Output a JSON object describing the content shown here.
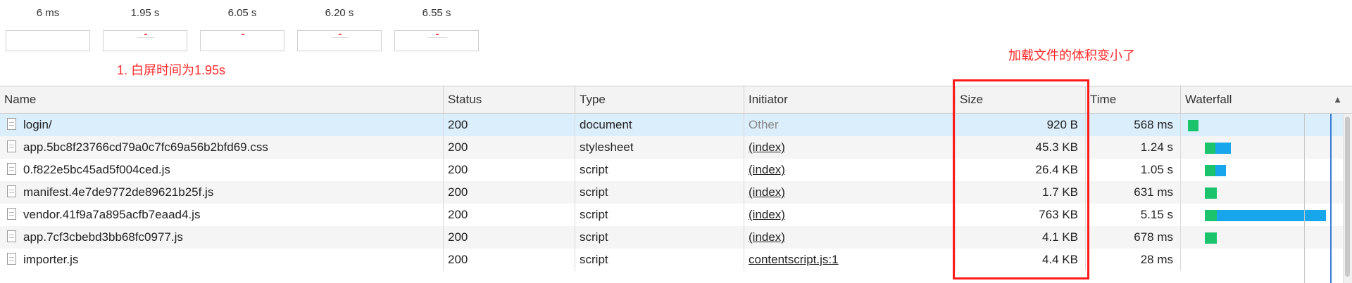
{
  "filmstrip": {
    "frames": [
      {
        "time": "6 ms"
      },
      {
        "time": "1.95 s"
      },
      {
        "time": "6.05 s"
      },
      {
        "time": "6.20 s"
      },
      {
        "time": "6.55 s"
      }
    ]
  },
  "annotations": {
    "white_screen": "1. 白屏时间为1.95s",
    "size_note": "加载文件的体积变小了"
  },
  "columns": {
    "name": "Name",
    "status": "Status",
    "type": "Type",
    "initiator": "Initiator",
    "size": "Size",
    "time": "Time",
    "waterfall": "Waterfall"
  },
  "rows": [
    {
      "name": "login/",
      "status": "200",
      "type": "document",
      "initiator": "Other",
      "size": "920 B",
      "time": "568 ms",
      "wf_green": [
        0.0,
        0.07
      ],
      "wf_blue": null
    },
    {
      "name": "app.5bc8f23766cd79a0c7fc69a56b2bfd69.css",
      "status": "200",
      "type": "stylesheet",
      "initiator": "(index)",
      "size": "45.3 KB",
      "time": "1.24 s",
      "wf_green": [
        0.11,
        0.18
      ],
      "wf_blue": [
        0.18,
        0.28
      ]
    },
    {
      "name": "0.f822e5bc45ad5f004ced.js",
      "status": "200",
      "type": "script",
      "initiator": "(index)",
      "size": "26.4 KB",
      "time": "1.05 s",
      "wf_green": [
        0.11,
        0.18
      ],
      "wf_blue": [
        0.18,
        0.25
      ]
    },
    {
      "name": "manifest.4e7de9772de89621b25f.js",
      "status": "200",
      "type": "script",
      "initiator": "(index)",
      "size": "1.7 KB",
      "time": "631 ms",
      "wf_green": [
        0.11,
        0.19
      ],
      "wf_blue": null
    },
    {
      "name": "vendor.41f9a7a895acfb7eaad4.js",
      "status": "200",
      "type": "script",
      "initiator": "(index)",
      "size": "763 KB",
      "time": "5.15 s",
      "wf_green": [
        0.11,
        0.19
      ],
      "wf_blue": [
        0.19,
        0.91
      ]
    },
    {
      "name": "app.7cf3cbebd3bb68fc0977.js",
      "status": "200",
      "type": "script",
      "initiator": "(index)",
      "size": "4.1 KB",
      "time": "678 ms",
      "wf_green": [
        0.11,
        0.19
      ],
      "wf_blue": null
    },
    {
      "name": "importer.js",
      "status": "200",
      "type": "script",
      "initiator": "contentscript.js:1",
      "size": "4.4 KB",
      "time": "28 ms",
      "wf_green": null,
      "wf_blue": null
    }
  ],
  "colors": {
    "wf_green": "#1cc36d",
    "wf_blue": "#17a6ec",
    "annotation": "#ff2a2a",
    "selected_row": "#dbeefb"
  },
  "icons": {
    "file": "file-icon",
    "sort": "sort-ascending-icon"
  }
}
